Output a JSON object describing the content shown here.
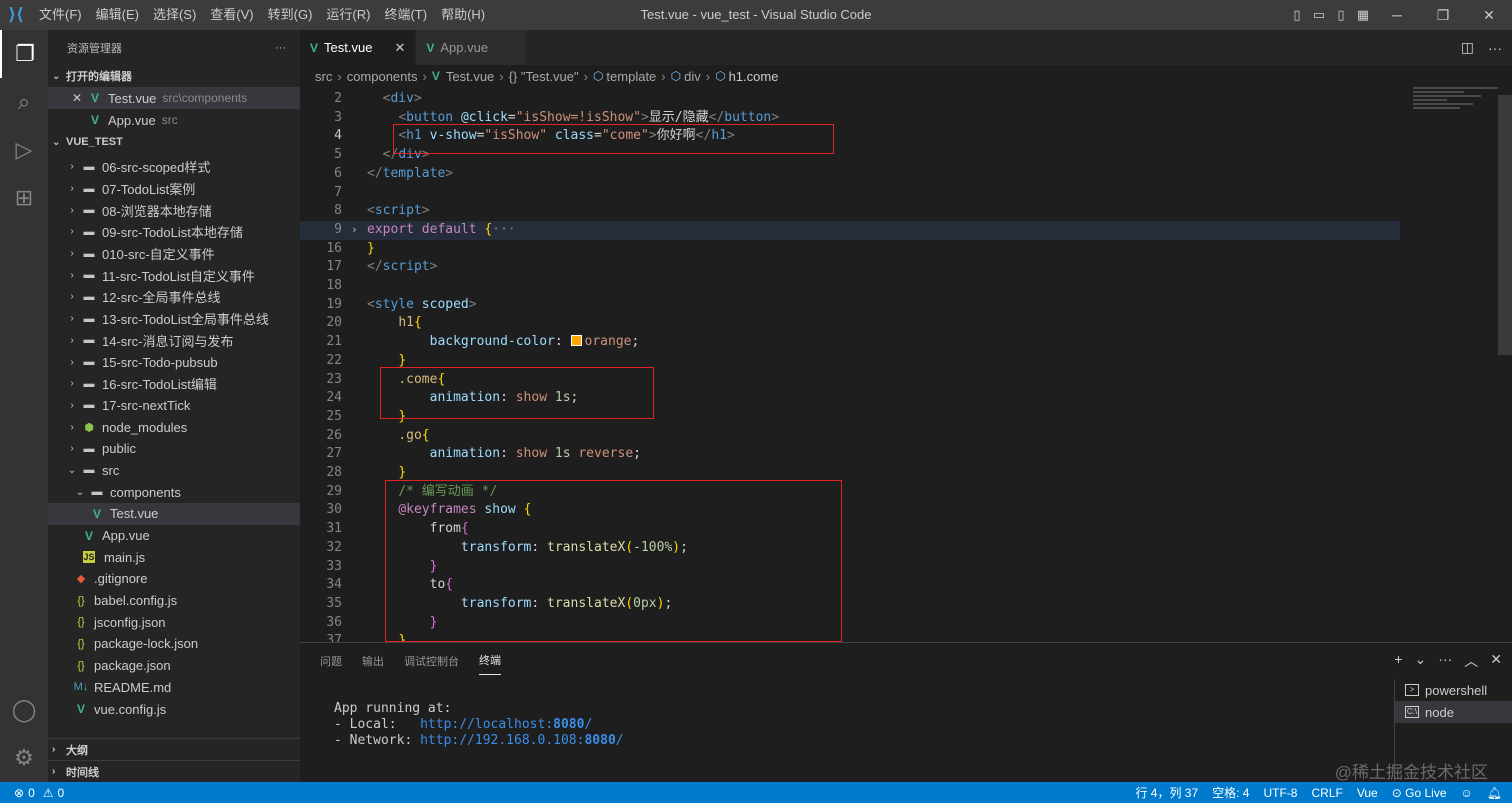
{
  "window_title": "Test.vue - vue_test - Visual Studio Code",
  "menu": [
    "文件(F)",
    "编辑(E)",
    "选择(S)",
    "查看(V)",
    "转到(G)",
    "运行(R)",
    "终端(T)",
    "帮助(H)"
  ],
  "sidebar": {
    "title": "资源管理器",
    "open_editors_title": "打开的编辑器",
    "open_editors": [
      {
        "name": "Test.vue",
        "path": "src\\components"
      },
      {
        "name": "App.vue",
        "path": "src"
      }
    ],
    "project_title": "VUE_TEST",
    "tree": [
      {
        "label": "06-src-scoped样式",
        "type": "folder"
      },
      {
        "label": "07-TodoList案例",
        "type": "folder"
      },
      {
        "label": "08-浏览器本地存储",
        "type": "folder"
      },
      {
        "label": "09-src-TodoList本地存储",
        "type": "folder"
      },
      {
        "label": "010-src-自定义事件",
        "type": "folder"
      },
      {
        "label": "11-src-TodoList自定义事件",
        "type": "folder"
      },
      {
        "label": "12-src-全局事件总线",
        "type": "folder"
      },
      {
        "label": "13-src-TodoList全局事件总线",
        "type": "folder"
      },
      {
        "label": "14-src-消息订阅与发布",
        "type": "folder"
      },
      {
        "label": "15-src-Todo-pubsub",
        "type": "folder"
      },
      {
        "label": "16-src-TodoList编辑",
        "type": "folder"
      },
      {
        "label": "17-src-nextTick",
        "type": "folder"
      },
      {
        "label": "node_modules",
        "type": "node"
      },
      {
        "label": "public",
        "type": "folder"
      },
      {
        "label": "src",
        "type": "open"
      },
      {
        "label": "components",
        "type": "open2"
      },
      {
        "label": "Test.vue",
        "type": "vue3"
      },
      {
        "label": "App.vue",
        "type": "vue2"
      },
      {
        "label": "main.js",
        "type": "js2"
      },
      {
        "label": ".gitignore",
        "type": "git"
      },
      {
        "label": "babel.config.js",
        "type": "json"
      },
      {
        "label": "jsconfig.json",
        "type": "json"
      },
      {
        "label": "package-lock.json",
        "type": "json"
      },
      {
        "label": "package.json",
        "type": "json"
      },
      {
        "label": "README.md",
        "type": "md"
      },
      {
        "label": "vue.config.js",
        "type": "vue1"
      }
    ],
    "outline_title": "大纲",
    "timeline_title": "时间线"
  },
  "tabs": [
    {
      "label": "Test.vue",
      "active": true
    },
    {
      "label": "App.vue",
      "active": false
    }
  ],
  "breadcrumb": [
    "src",
    "components",
    "Test.vue",
    "{} \"Test.vue\"",
    "template",
    "div",
    "h1.come"
  ],
  "code_lines": [
    "2",
    "3",
    "4",
    "5",
    "6",
    "7",
    "8",
    "9",
    "16",
    "17",
    "18",
    "19",
    "20",
    "21",
    "22",
    "23",
    "24",
    "25",
    "26",
    "27",
    "28",
    "29",
    "30",
    "31",
    "32",
    "33",
    "34",
    "35",
    "36",
    "37"
  ],
  "code": {
    "l_button_text": "显示/隐藏",
    "l_h1_text": "你好啊",
    "l_comment": "/* 编写动画 */"
  },
  "panel": {
    "tabs": [
      "问题",
      "输出",
      "调试控制台",
      "终端"
    ],
    "terminal_lines": [
      "App running at:",
      "- Local:   ",
      "- Network: "
    ],
    "local_url": "http://localhost:",
    "network_url": "http://192.168.0.108:",
    "port": "8080",
    "terminals": [
      "powershell",
      "node"
    ]
  },
  "status": {
    "errors": "0",
    "warnings": "0",
    "position": "行 4，列 37",
    "spaces": "空格: 4",
    "encoding": "UTF-8",
    "eol": "CRLF",
    "language": "Vue",
    "golive": "Go Live"
  },
  "watermark": "@稀土掘金技术社区",
  "colors": {
    "statusbar": "#007acc",
    "highlight_box": "#e02424",
    "accent_vue": "#41b883"
  }
}
